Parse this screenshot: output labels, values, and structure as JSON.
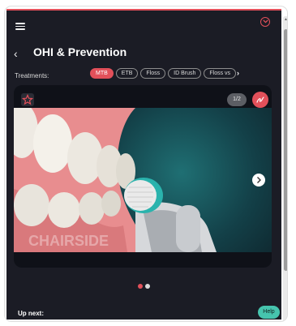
{
  "header": {
    "menu_icon": "hamburger-menu-icon",
    "collapse_icon": "chevron-down-circle-icon",
    "accent_color": "#e2505a"
  },
  "page": {
    "back_icon": "chevron-left-icon",
    "back_glyph": "‹",
    "title": "OHI & Prevention"
  },
  "treatments": {
    "label": "Treatments:",
    "chips": [
      "MTB",
      "ETB",
      "Floss",
      "ID Brush",
      "Floss vs"
    ],
    "active_index": 0,
    "more_glyph": "›"
  },
  "viewer": {
    "favorite_icon": "star-outline-icon",
    "counter": "1/2",
    "annotate_icon": "pen-scribble-icon",
    "next_icon": "chevron-right-icon",
    "image_caption": "Electric toothbrush head on teeth",
    "watermark": "CHAIRSIDE",
    "pagination": {
      "count": 2,
      "active": 0,
      "active_color": "#e2505a",
      "inactive_color": "#d9d9d9"
    }
  },
  "footer": {
    "up_next_label": "Up next:",
    "help_label": "Help",
    "help_color": "#46c4ae"
  }
}
